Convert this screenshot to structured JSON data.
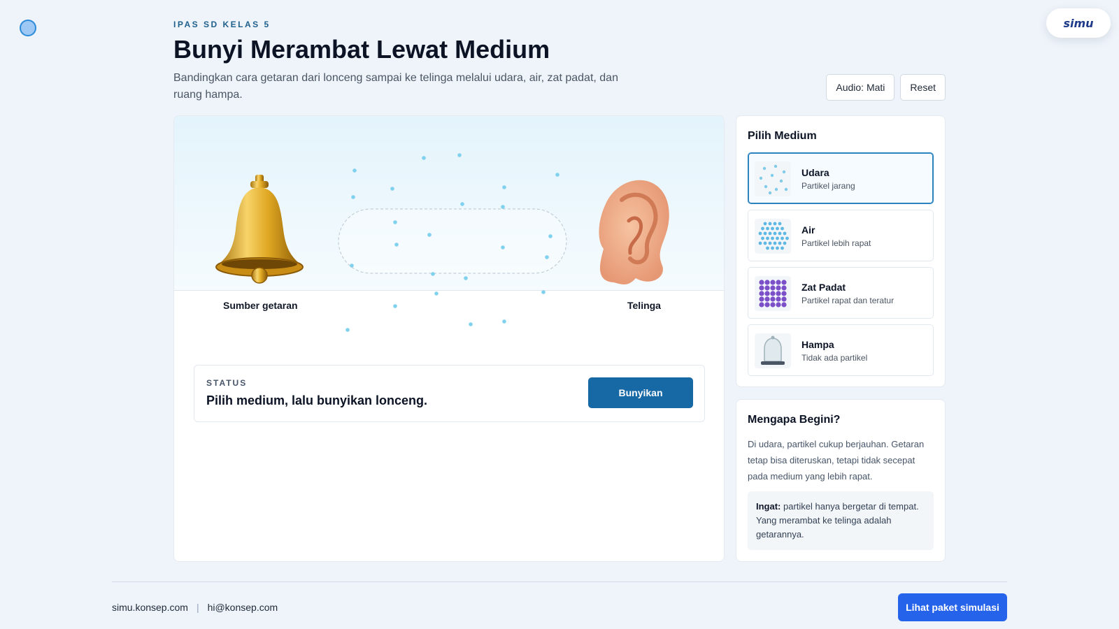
{
  "header": {
    "kicker": "IPAS SD KELAS 5",
    "title": "Bunyi Merambat Lewat Medium",
    "subtitle": "Bandingkan cara getaran dari lonceng sampai ke telinga melalui udara, air, zat padat, dan ruang hampa."
  },
  "brand": {
    "logo_text": "simu"
  },
  "actions": {
    "audio_label": "Audio: Mati",
    "reset_label": "Reset"
  },
  "stage": {
    "source_label": "Sumber getaran",
    "receiver_label": "Telinga",
    "status_kicker": "STATUS",
    "status_text": "Pilih medium, lalu bunyikan lonceng.",
    "ring_button": "Bunyikan"
  },
  "medium_panel": {
    "title": "Pilih Medium",
    "selected": "Udara",
    "items": [
      {
        "name": "Udara",
        "desc": "Partikel jarang",
        "icon": "sparse-particles-icon"
      },
      {
        "name": "Air",
        "desc": "Partikel lebih rapat",
        "icon": "dense-particles-icon"
      },
      {
        "name": "Zat Padat",
        "desc": "Partikel rapat dan teratur",
        "icon": "solid-lattice-icon"
      },
      {
        "name": "Hampa",
        "desc": "Tidak ada partikel",
        "icon": "bell-jar-icon"
      }
    ]
  },
  "why_panel": {
    "title": "Mengapa Begini?",
    "body": "Di udara, partikel cukup berjauhan. Getaran tetap bisa diteruskan, tetapi tidak secepat pada medium yang lebih rapat.",
    "remember_label": "Ingat:",
    "remember_text": " partikel hanya bergetar di tempat. Yang merambat ke telinga adalah getarannya."
  },
  "footer": {
    "website": "simu.konsep.com",
    "separator": "|",
    "email": "hi@konsep.com",
    "cta": "Lihat paket simulasi"
  },
  "colors": {
    "accent": "#1769a6",
    "cta": "#2563eb",
    "particle": "#7fd1ee"
  }
}
